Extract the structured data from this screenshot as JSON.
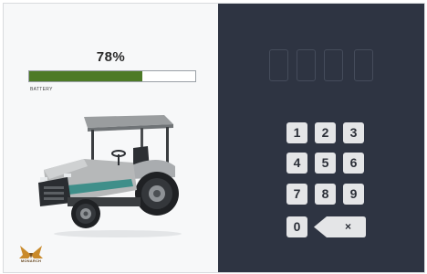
{
  "battery": {
    "percent_text": "78%",
    "level": 0.68,
    "label": "BATTERY",
    "fill_color": "#4d7a27"
  },
  "brand": {
    "logo_icon": "monarch-wing-icon",
    "name": "MONARCH"
  },
  "image": {
    "icon": "electric-tractor"
  },
  "pin_entry": {
    "digit_count": 4,
    "digits": [
      "",
      "",
      "",
      ""
    ]
  },
  "keypad": {
    "keys": [
      "1",
      "2",
      "3",
      "4",
      "5",
      "6",
      "7",
      "8",
      "9",
      "0"
    ],
    "backspace_label": "×"
  },
  "colors": {
    "panel_dark": "#2e3442",
    "key_background": "#e4e5e7"
  }
}
